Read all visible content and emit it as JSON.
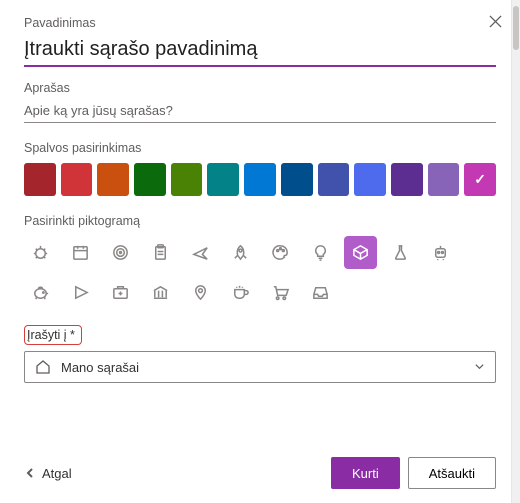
{
  "labels": {
    "title": "Pavadinimas",
    "desc": "Aprašas",
    "color": "Spalvos pasirinkimas",
    "icon": "Pasirinkti piktogramą",
    "saveTo": "Įrašyti į *"
  },
  "title_value": "Įtraukti sąrašo pavadinimą",
  "desc_placeholder": "Apie ką yra jūsų sąrašas?",
  "colors": [
    {
      "name": "dark-red",
      "hex": "#a4262c",
      "selected": false
    },
    {
      "name": "red",
      "hex": "#d13438",
      "selected": false
    },
    {
      "name": "orange",
      "hex": "#ca5010",
      "selected": false
    },
    {
      "name": "dark-green",
      "hex": "#0b6a0b",
      "selected": false
    },
    {
      "name": "green",
      "hex": "#498205",
      "selected": false
    },
    {
      "name": "teal",
      "hex": "#038387",
      "selected": false
    },
    {
      "name": "cyan",
      "hex": "#0078d4",
      "selected": false
    },
    {
      "name": "blue",
      "hex": "#004e8c",
      "selected": false
    },
    {
      "name": "royal-blue",
      "hex": "#4052ab",
      "selected": false
    },
    {
      "name": "indigo",
      "hex": "#4f6bed",
      "selected": false
    },
    {
      "name": "dark-purple",
      "hex": "#5c2e91",
      "selected": false
    },
    {
      "name": "purple",
      "hex": "#8764b8",
      "selected": false
    },
    {
      "name": "pink",
      "hex": "#c239b3",
      "selected": true
    }
  ],
  "icons": [
    "bug",
    "calendar",
    "target",
    "clipboard",
    "airplane",
    "rocket",
    "palette",
    "lightbulb",
    "cube",
    "flask",
    "robot",
    "piggy-bank",
    "play",
    "first-aid",
    "bank",
    "location",
    "coffee",
    "cart",
    "inbox"
  ],
  "selected_icon": "cube",
  "dropdown": {
    "selected": "Mano sąrašai"
  },
  "buttons": {
    "back": "Atgal",
    "create": "Kurti",
    "cancel": "Atšaukti"
  }
}
